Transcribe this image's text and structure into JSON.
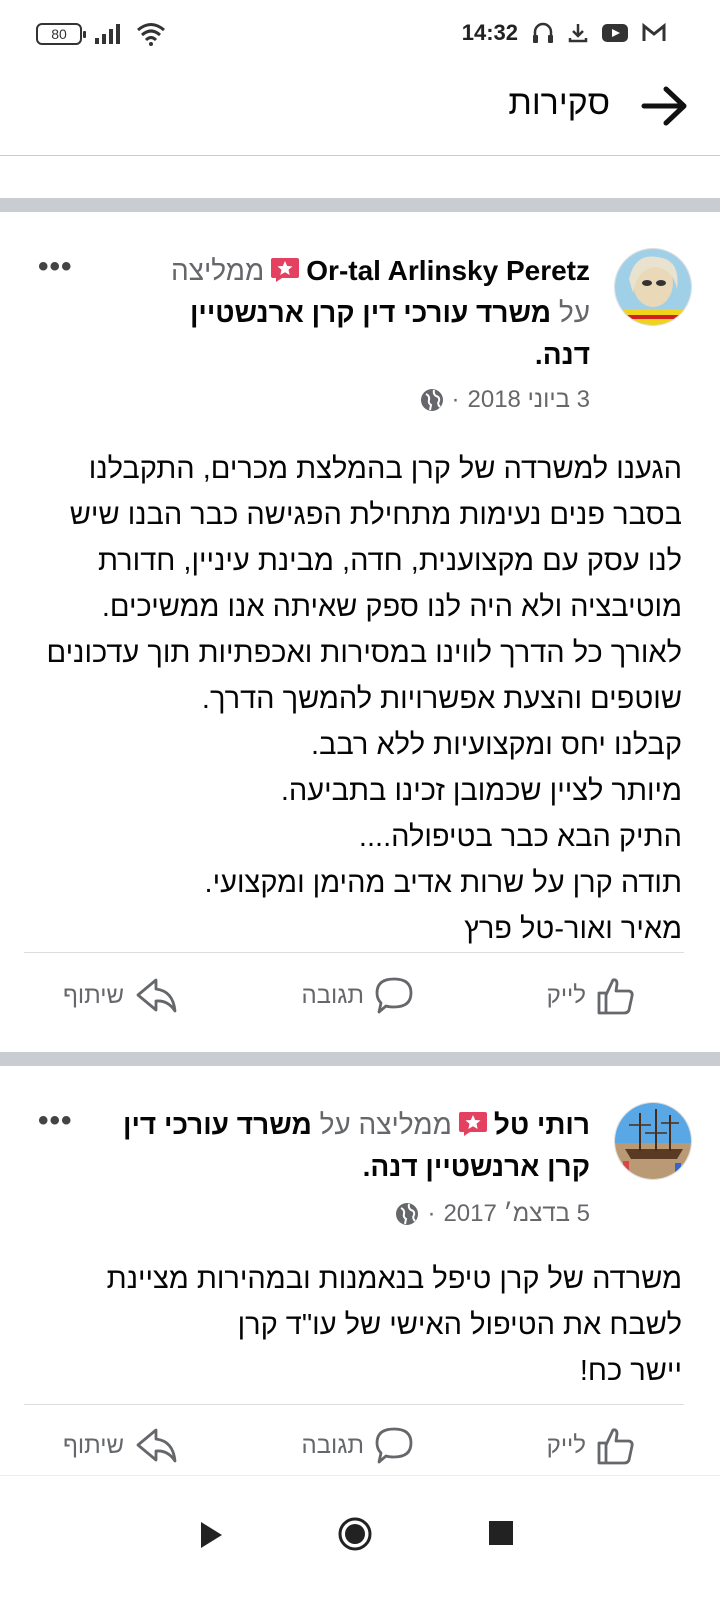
{
  "status_bar": {
    "battery": "80",
    "time": "14:32",
    "icons": [
      "battery-icon",
      "signal-icon",
      "wifi-icon",
      "gmail-icon",
      "youtube-icon",
      "download-icon",
      "headset-icon"
    ]
  },
  "header": {
    "title": "סקירות",
    "back_icon": "arrow-right-icon"
  },
  "posts": [
    {
      "author": "Or-tal Arlinsky Peretz",
      "recommends": "ממליצה",
      "on": "על",
      "page": "משרד עורכי דין קרן ארנשטיין דנה",
      "date": "3 ביוני 2018",
      "body": "הגענו למשרדה של קרן בהמלצת מכרים, התקבלנו בסבר פנים נעימות מתחילת הפגישה כבר הבנו שיש לנו עסק עם מקצוענית, חדה, מבינת עיניין, חדורת מוטיבציה ולא היה לנו ספק שאיתה אנו ממשיכים.\nלאורך כל הדרך לווינו במסירות ואכפתיות תוך עדכונים שוטפים והצעת אפשרויות להמשך הדרך.\nקבלנו יחס ומקצועיות ללא רבב.\nמיותר לציין שכמובן זכינו בתביעה.\nהתיק הבא כבר בטיפולה....\nתודה קרן על שרות אדיב מהימן ומקצועי.\nמאיר ואור-טל פרץ"
    },
    {
      "author": "רותי טל",
      "recommends": "ממליצה",
      "on": "על",
      "page": "משרד עורכי דין קרן ארנשטיין דנה",
      "date": "5 בדצמ׳ 2017",
      "body": "משרדה של קרן טיפל בנאמנות ובמהירות מציינת\nלשבח את הטיפול האישי של עו\"ד קרן\nיישר כח!"
    }
  ],
  "actions": {
    "like": "לייק",
    "comment": "תגובה",
    "share": "שיתוף"
  },
  "colors": {
    "text": "#050505",
    "secondary": "#65676b",
    "divider": "#c9ccd1",
    "badge": "#e4405f"
  }
}
